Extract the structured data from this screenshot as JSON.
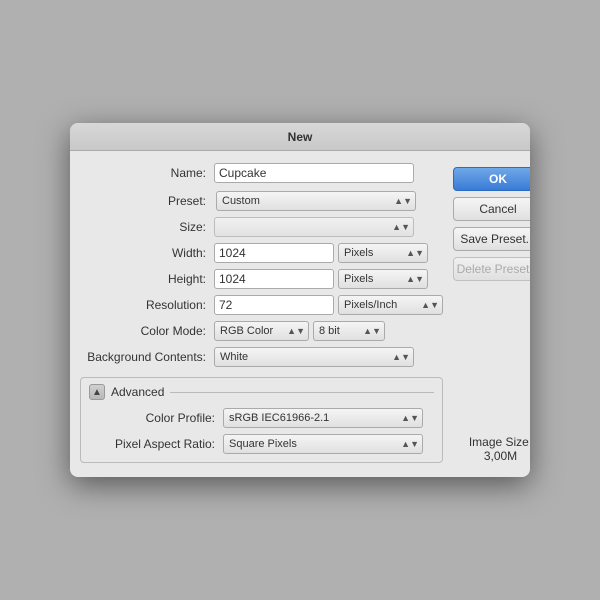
{
  "dialog": {
    "title": "New",
    "name_label": "Name:",
    "name_value": "Cupcake",
    "preset_label": "Preset:",
    "preset_value": "Custom",
    "size_label": "Size:",
    "width_label": "Width:",
    "width_value": "1024",
    "height_label": "Height:",
    "height_value": "1024",
    "resolution_label": "Resolution:",
    "resolution_value": "72",
    "color_mode_label": "Color Mode:",
    "color_mode_value": "RGB Color",
    "bit_depth_value": "8 bit",
    "background_label": "Background Contents:",
    "background_value": "White",
    "advanced_label": "Advanced",
    "color_profile_label": "Color Profile:",
    "color_profile_value": "sRGB IEC61966-2.1",
    "pixel_aspect_label": "Pixel Aspect Ratio:",
    "pixel_aspect_value": "Square Pixels",
    "width_unit": "Pixels",
    "height_unit": "Pixels",
    "resolution_unit": "Pixels/Inch",
    "image_size_label": "Image Size:",
    "image_size_value": "3,00M",
    "buttons": {
      "ok": "OK",
      "cancel": "Cancel",
      "save_preset": "Save Preset...",
      "delete_preset": "Delete Preset..."
    }
  }
}
